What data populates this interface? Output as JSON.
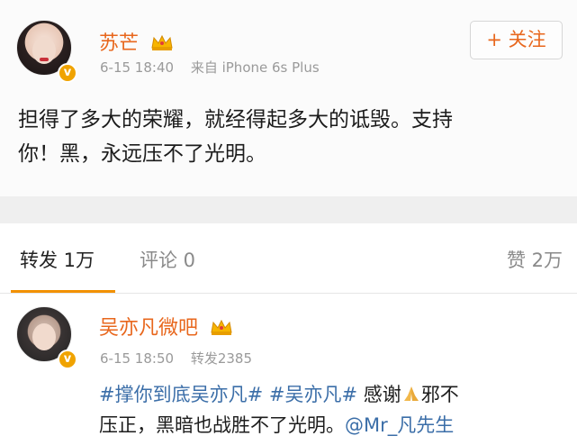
{
  "post": {
    "author": "苏芒",
    "date": "6-15 18:40",
    "source": "来自 iPhone 6s Plus",
    "follow_label": "+ 关注",
    "text_line1": "担得了多大的荣耀，就经得起多大的诋毁。支持",
    "text_line2": "你！黑，永远压不了光明。"
  },
  "tabs": {
    "repost": "转发 1万",
    "comment": "评论 0",
    "like": "赞 2万"
  },
  "reply": {
    "author": "吴亦凡微吧",
    "date": "6-15 18:50",
    "repost_count": "转发2385",
    "topic1": "#撑你到底吴亦凡#",
    "topic2": "#吴亦凡#",
    "thanks": " 感谢",
    "after_emoji": "邪不",
    "line2_text": "压正，黑暗也战胜不了光明。",
    "mention": "@Mr_凡先生"
  },
  "colors": {
    "accent": "#e8671d",
    "link": "#3b6ea8",
    "tab_underline": "#f29100"
  }
}
